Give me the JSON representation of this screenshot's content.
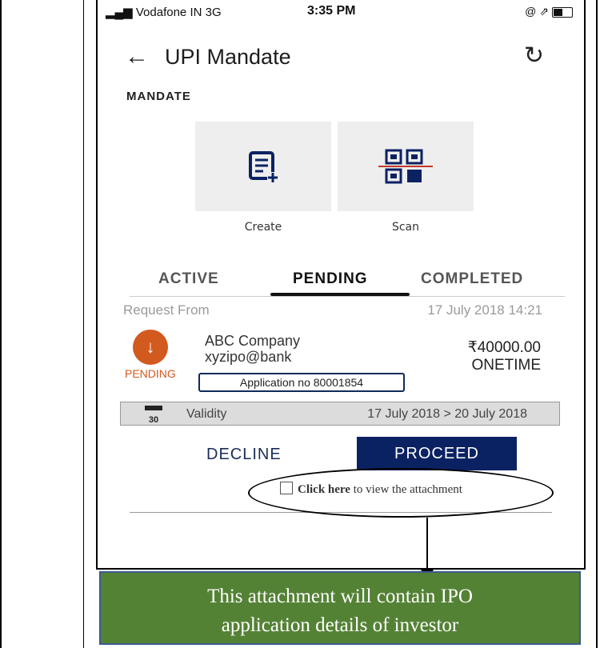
{
  "status_bar": {
    "carrier": "Vodafone IN  3G",
    "time": "3:35 PM",
    "right_icons": "@ ⇗"
  },
  "header": {
    "back_icon": "←",
    "title": "UPI Mandate",
    "refresh_icon": "↻"
  },
  "section_label": "MANDATE",
  "tiles": [
    {
      "label": "Create",
      "icon": "create-doc-icon"
    },
    {
      "label": "Scan",
      "icon": "qr-scan-icon"
    }
  ],
  "tabs": [
    {
      "label": "ACTIVE"
    },
    {
      "label": "PENDING"
    },
    {
      "label": "COMPLETED"
    }
  ],
  "request": {
    "label": "Request From",
    "date": "17 July 2018 14:21",
    "status_icon": "↓",
    "status": "PENDING",
    "company": "ABC Company",
    "vpa": "xyzipo@bank",
    "amount": "₹40000.00",
    "frequency": "ONETIME",
    "application": "Application no 80001854",
    "validity_label": "Validity",
    "validity_range": "17 July 2018 > 20 July 2018",
    "calendar_day": "30"
  },
  "actions": {
    "decline": "DECLINE",
    "proceed": "PROCEED"
  },
  "attachment": {
    "link": "Click here",
    "rest": " to view the attachment"
  },
  "callout": {
    "line1": "This attachment will contain IPO",
    "line2": "application details of investor"
  },
  "colors": {
    "navy": "#0b2262",
    "pending_orange": "#d35a1f",
    "callout_green": "#548235"
  }
}
